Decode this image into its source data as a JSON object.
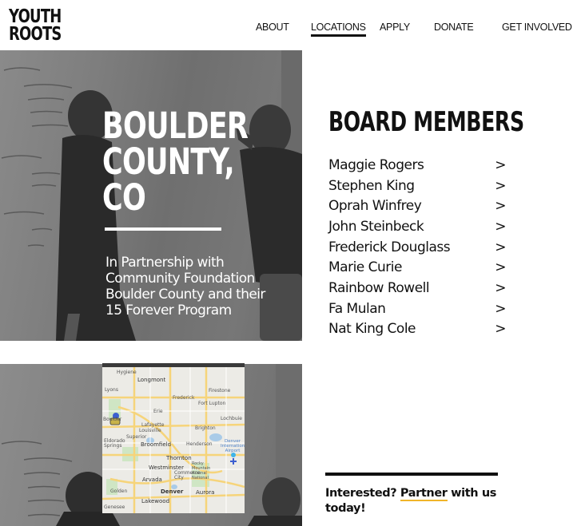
{
  "logo": {
    "line1": "YOUTH",
    "line2": "ROOTS"
  },
  "nav": {
    "items": [
      {
        "label": "ABOUT",
        "active": false
      },
      {
        "label": "LOCATIONS",
        "active": true
      },
      {
        "label": "APPLY",
        "active": false
      },
      {
        "label": "DONATE",
        "active": false
      },
      {
        "label": "GET INVOLVED",
        "active": false
      }
    ]
  },
  "hero": {
    "title_lines": [
      "BOULDER",
      "COUNTY,",
      "CO"
    ],
    "subtitle": "In Partnership with Community Foundation Boulder County and their 15 Forever Program"
  },
  "board": {
    "title": "BOARD MEMBERS",
    "chevron": ">",
    "members": [
      "Maggie Rogers",
      "Stephen King",
      "Oprah Winfrey",
      "John Steinbeck",
      "Frederick Douglass",
      "Marie Curie",
      "Rainbow Rowell",
      "Fa Mulan",
      "Nat King Cole"
    ]
  },
  "map": {
    "labels": [
      "Hygiene",
      "Longmont",
      "Lyons",
      "Frederick",
      "Firestone",
      "Fort Lupton",
      "Erie",
      "Boulder",
      "Lafayette",
      "Louisville",
      "Superior",
      "Brighton",
      "Lochbuie",
      "Eldorado Springs",
      "Broomfield",
      "Henderson",
      "Denver International Airport",
      "Thornton",
      "Rocky Mountain Arsenal National",
      "Westminster",
      "Commerce City",
      "Arvada",
      "Golden",
      "Denver",
      "Aurora",
      "Lakewood",
      "Genesee"
    ]
  },
  "cta": {
    "prefix": "Interested? ",
    "link": "Partner",
    "suffix": " with us today!"
  },
  "colors": {
    "accent_underline": "#f0b429",
    "text": "#111111"
  }
}
